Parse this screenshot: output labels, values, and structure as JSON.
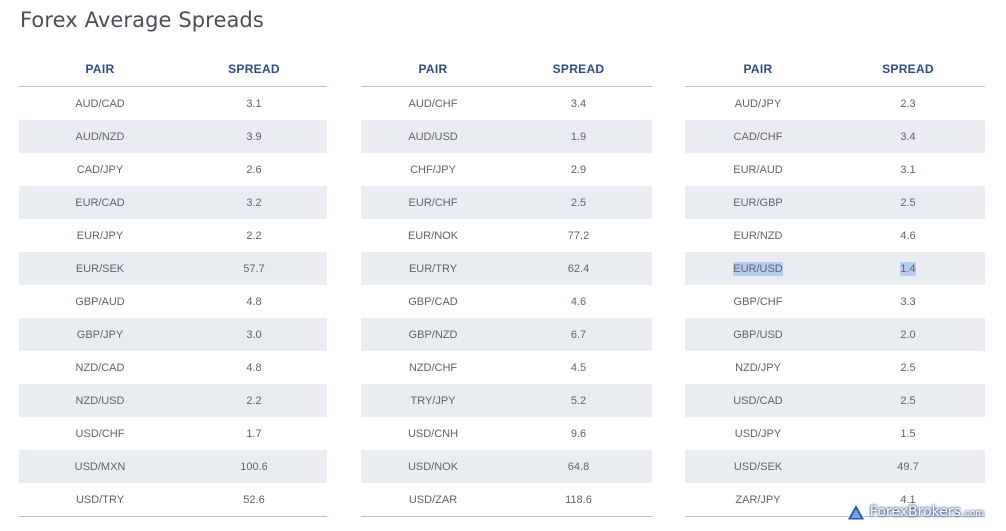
{
  "title": "Forex Average Spreads",
  "headers": {
    "pair": "PAIR",
    "spread": "SPREAD"
  },
  "tables": [
    {
      "rows": [
        {
          "pair": "AUD/CAD",
          "spread": "3.1"
        },
        {
          "pair": "AUD/NZD",
          "spread": "3.9"
        },
        {
          "pair": "CAD/JPY",
          "spread": "2.6"
        },
        {
          "pair": "EUR/CAD",
          "spread": "3.2"
        },
        {
          "pair": "EUR/JPY",
          "spread": "2.2"
        },
        {
          "pair": "EUR/SEK",
          "spread": "57.7"
        },
        {
          "pair": "GBP/AUD",
          "spread": "4.8"
        },
        {
          "pair": "GBP/JPY",
          "spread": "3.0"
        },
        {
          "pair": "NZD/CAD",
          "spread": "4.8"
        },
        {
          "pair": "NZD/USD",
          "spread": "2.2"
        },
        {
          "pair": "USD/CHF",
          "spread": "1.7"
        },
        {
          "pair": "USD/MXN",
          "spread": "100.6"
        },
        {
          "pair": "USD/TRY",
          "spread": "52.6"
        }
      ]
    },
    {
      "rows": [
        {
          "pair": "AUD/CHF",
          "spread": "3.4"
        },
        {
          "pair": "AUD/USD",
          "spread": "1.9"
        },
        {
          "pair": "CHF/JPY",
          "spread": "2.9"
        },
        {
          "pair": "EUR/CHF",
          "spread": "2.5"
        },
        {
          "pair": "EUR/NOK",
          "spread": "77.2"
        },
        {
          "pair": "EUR/TRY",
          "spread": "62.4"
        },
        {
          "pair": "GBP/CAD",
          "spread": "4.6"
        },
        {
          "pair": "GBP/NZD",
          "spread": "6.7"
        },
        {
          "pair": "NZD/CHF",
          "spread": "4.5"
        },
        {
          "pair": "TRY/JPY",
          "spread": "5.2"
        },
        {
          "pair": "USD/CNH",
          "spread": "9.6"
        },
        {
          "pair": "USD/NOK",
          "spread": "64.8"
        },
        {
          "pair": "USD/ZAR",
          "spread": "118.6"
        }
      ]
    },
    {
      "rows": [
        {
          "pair": "AUD/JPY",
          "spread": "2.3"
        },
        {
          "pair": "CAD/CHF",
          "spread": "3.4"
        },
        {
          "pair": "EUR/AUD",
          "spread": "3.1"
        },
        {
          "pair": "EUR/GBP",
          "spread": "2.5"
        },
        {
          "pair": "EUR/NZD",
          "spread": "4.6"
        },
        {
          "pair": "EUR/USD",
          "spread": "1.4"
        },
        {
          "pair": "GBP/CHF",
          "spread": "3.3"
        },
        {
          "pair": "GBP/USD",
          "spread": "2.0"
        },
        {
          "pair": "NZD/JPY",
          "spread": "2.5"
        },
        {
          "pair": "USD/CAD",
          "spread": "2.5"
        },
        {
          "pair": "USD/JPY",
          "spread": "1.5"
        },
        {
          "pair": "USD/SEK",
          "spread": "49.7"
        },
        {
          "pair": "ZAR/JPY",
          "spread": "4.1"
        }
      ]
    }
  ],
  "highlight": {
    "table": 2,
    "row": 5,
    "color": "#b6cfee"
  },
  "colors": {
    "header_text": "#2f4b8f",
    "cell_text": "#5c6470",
    "stripe": "#e9edf2",
    "rule": "#b8bfcc"
  },
  "watermark": {
    "icon": "forexbrokers-logo-icon",
    "brand": "ForexBrokers",
    "suffix": ".com"
  }
}
